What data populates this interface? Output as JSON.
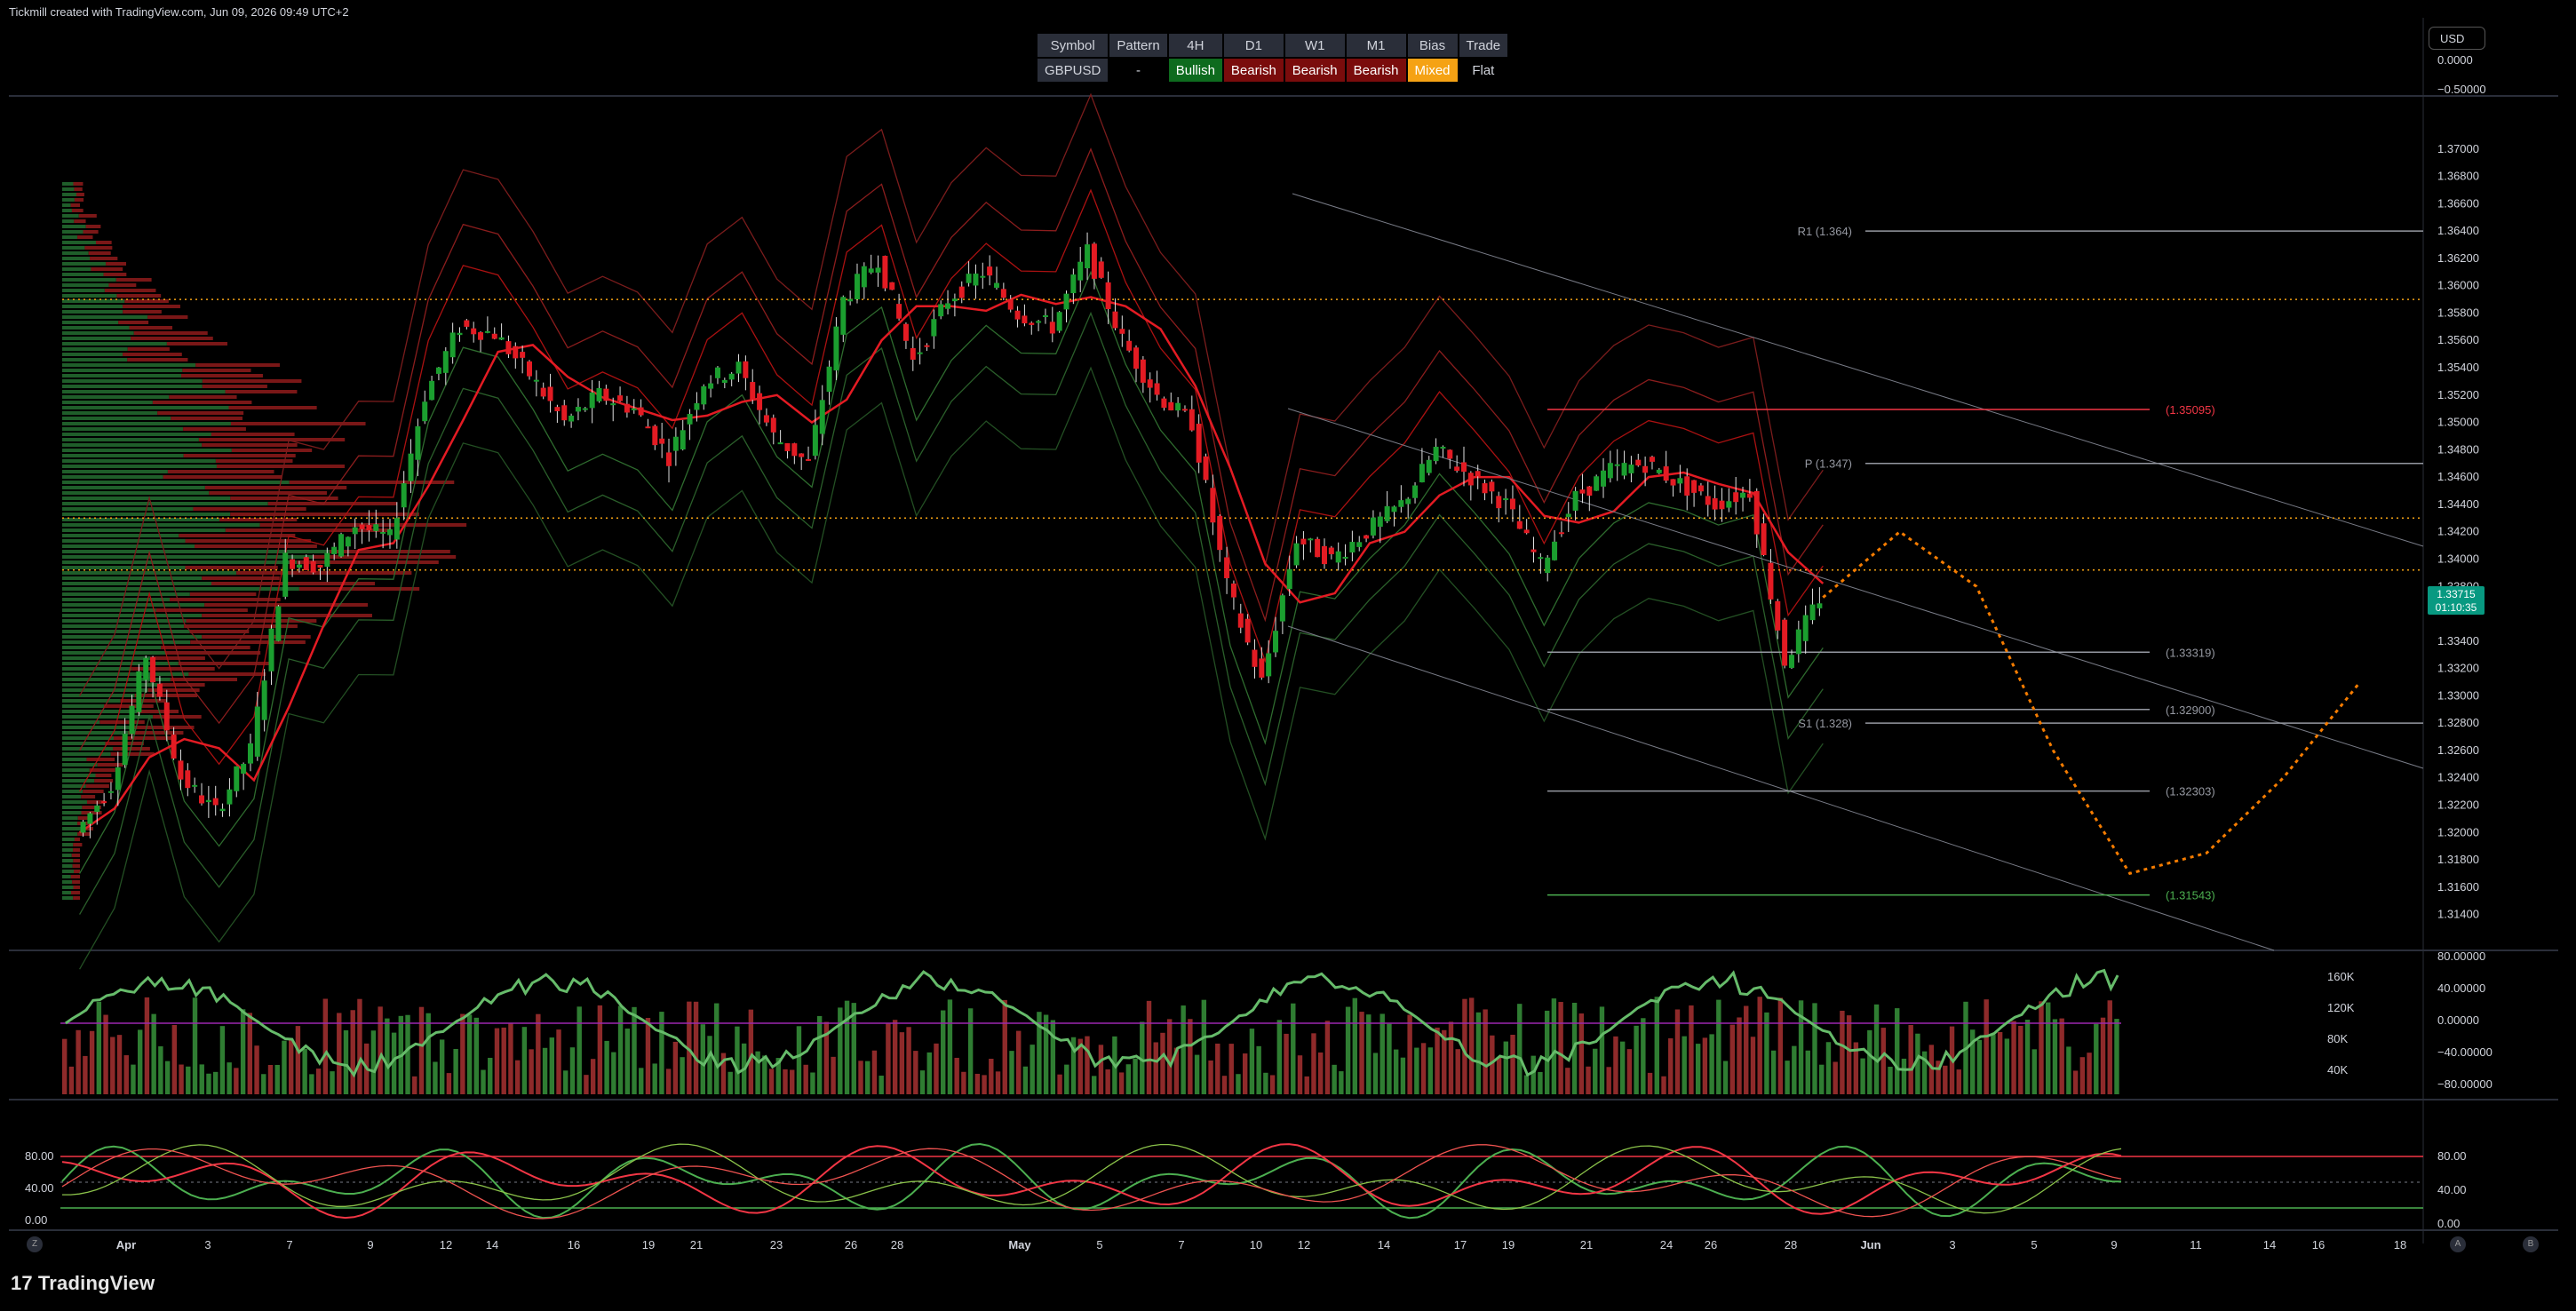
{
  "header": {
    "attribution": "Tickmill created with TradingView.com, Jun 09, 2026 09:49 UTC+2",
    "currency": "USD"
  },
  "bias_table": {
    "headers": [
      "Symbol",
      "Pattern",
      "4H",
      "D1",
      "W1",
      "M1",
      "Bias",
      "Trade"
    ],
    "values": [
      "GBPUSD",
      "-",
      "Bullish",
      "Bearish",
      "Bearish",
      "Bearish",
      "Mixed",
      "Flat"
    ],
    "colors": {
      "bullish": "#0e6b1e",
      "bearish": "#7a0c0c",
      "mixed": "#f5a214"
    }
  },
  "chart_data": [
    {
      "type": "candlestick",
      "title": "",
      "symbol": "GBPUSD",
      "ylim": [
        1.313,
        1.372
      ],
      "y_ticks": [
        "1.37000",
        "1.36800",
        "1.36600",
        "1.36400",
        "1.36200",
        "1.36000",
        "1.35800",
        "1.35600",
        "1.35400",
        "1.35200",
        "1.35000",
        "1.34800",
        "1.34600",
        "1.34400",
        "1.34200",
        "1.34000",
        "1.33800",
        "1.33400",
        "1.33200",
        "1.33000",
        "1.32800",
        "1.32600",
        "1.32400",
        "1.32200",
        "1.32000",
        "1.31800",
        "1.31600",
        "1.31400"
      ],
      "last_price": {
        "value": "1.33715",
        "countdown": "01:10:35",
        "color": "#089981"
      },
      "price_path": [
        {
          "t": "Mar 30",
          "p": 1.32
        },
        {
          "t": "Apr 1",
          "p": 1.3235
        },
        {
          "t": "Apr 2",
          "p": 1.333
        },
        {
          "t": "Apr 3",
          "p": 1.324
        },
        {
          "t": "Apr 6",
          "p": 1.3215
        },
        {
          "t": "Apr 7",
          "p": 1.326
        },
        {
          "t": "Apr 8",
          "p": 1.34
        },
        {
          "t": "Apr 9",
          "p": 1.3395
        },
        {
          "t": "Apr 10",
          "p": 1.3425
        },
        {
          "t": "Apr 13",
          "p": 1.3415
        },
        {
          "t": "Apr 14",
          "p": 1.352
        },
        {
          "t": "Apr 15",
          "p": 1.357
        },
        {
          "t": "Apr 16",
          "p": 1.3565
        },
        {
          "t": "Apr 17",
          "p": 1.3535
        },
        {
          "t": "Apr 20",
          "p": 1.35
        },
        {
          "t": "Apr 21",
          "p": 1.352
        },
        {
          "t": "Apr 22",
          "p": 1.351
        },
        {
          "t": "Apr 23",
          "p": 1.3475
        },
        {
          "t": "Apr 24",
          "p": 1.353
        },
        {
          "t": "Apr 27",
          "p": 1.354
        },
        {
          "t": "Apr 28",
          "p": 1.349
        },
        {
          "t": "Apr 29",
          "p": 1.347
        },
        {
          "t": "Apr 30",
          "p": 1.359
        },
        {
          "t": "May 1",
          "p": 1.362
        },
        {
          "t": "May 4",
          "p": 1.3545
        },
        {
          "t": "May 5",
          "p": 1.359
        },
        {
          "t": "May 6",
          "p": 1.361
        },
        {
          "t": "May 7",
          "p": 1.358
        },
        {
          "t": "May 8",
          "p": 1.357
        },
        {
          "t": "May 11",
          "p": 1.3625
        },
        {
          "t": "May 12",
          "p": 1.356
        },
        {
          "t": "May 13",
          "p": 1.352
        },
        {
          "t": "May 14",
          "p": 1.35
        },
        {
          "t": "May 15",
          "p": 1.338
        },
        {
          "t": "May 18",
          "p": 1.331
        },
        {
          "t": "May 19",
          "p": 1.3415
        },
        {
          "t": "May 20",
          "p": 1.34
        },
        {
          "t": "May 21",
          "p": 1.342
        },
        {
          "t": "May 22",
          "p": 1.344
        },
        {
          "t": "May 25",
          "p": 1.348
        },
        {
          "t": "May 26",
          "p": 1.346
        },
        {
          "t": "May 27",
          "p": 1.344
        },
        {
          "t": "May 28",
          "p": 1.3395
        },
        {
          "t": "May 29",
          "p": 1.3445
        },
        {
          "t": "Jun 1",
          "p": 1.3465
        },
        {
          "t": "Jun 2",
          "p": 1.347
        },
        {
          "t": "Jun 3",
          "p": 1.3455
        },
        {
          "t": "Jun 4",
          "p": 1.344
        },
        {
          "t": "Jun 5",
          "p": 1.345
        },
        {
          "t": "Jun 8",
          "p": 1.3325
        },
        {
          "t": "Jun 9",
          "p": 1.33715
        }
      ],
      "levels": [
        {
          "label": "R1 (1.364)",
          "value": 1.364,
          "color": "#9598a1"
        },
        {
          "label": "(1.35095)",
          "value": 1.35095,
          "color": "#f23645"
        },
        {
          "label": "P (1.347)",
          "value": 1.347,
          "color": "#9598a1"
        },
        {
          "label": "(1.33319)",
          "value": 1.33319,
          "color": "#9598a1"
        },
        {
          "label": "S1 (1.328)",
          "value": 1.328,
          "color": "#9598a1"
        },
        {
          "label": "(1.32900)",
          "value": 1.329,
          "color": "#9598a1"
        },
        {
          "label": "(1.32303)",
          "value": 1.32303,
          "color": "#9598a1"
        },
        {
          "label": "(1.31543)",
          "value": 1.31543,
          "color": "#4caf50"
        }
      ],
      "dotted_levels": [
        1.359,
        1.343,
        1.3392
      ],
      "projection": {
        "color": "#f57c00",
        "points": [
          {
            "t": "Jun 9",
            "p": 1.3372
          },
          {
            "t": "Jun 10",
            "p": 1.342
          },
          {
            "t": "Jun 11",
            "p": 1.338
          },
          {
            "t": "Jun 12",
            "p": 1.326
          },
          {
            "t": "Jun 13",
            "p": 1.317
          },
          {
            "t": "Jun 14",
            "p": 1.3185
          },
          {
            "t": "Jun 16",
            "p": 1.324
          },
          {
            "t": "Jun 17",
            "p": 1.331
          }
        ]
      }
    },
    {
      "type": "bar",
      "title": "",
      "name": "volume",
      "y_ticks_left": [
        "160K",
        "120K",
        "80K",
        "40K"
      ],
      "y_ticks_right": [
        "80.00000",
        "40.00000",
        "0.00000",
        "−40.00000",
        "−80.00000"
      ]
    },
    {
      "type": "line",
      "title": "",
      "name": "stochastic",
      "y_ticks_left": [
        "80.00",
        "40.00",
        "0.00"
      ],
      "y_ticks_right": [
        "80.00",
        "40.00",
        "0.00"
      ],
      "ylim": [
        0,
        100
      ],
      "bands": [
        80,
        20
      ]
    }
  ],
  "x_axis": {
    "labels": [
      "Apr",
      "3",
      "7",
      "9",
      "12",
      "14",
      "16",
      "19",
      "21",
      "23",
      "26",
      "28",
      "May",
      "5",
      "7",
      "10",
      "12",
      "14",
      "17",
      "19",
      "21",
      "24",
      "26",
      "28",
      "Jun",
      "3",
      "5",
      "9",
      "11",
      "14",
      "16",
      "18"
    ]
  },
  "price_axis_top": [
    "0.0000",
    "−0.50000"
  ],
  "brand": {
    "name": "TradingView",
    "mark": "17"
  }
}
